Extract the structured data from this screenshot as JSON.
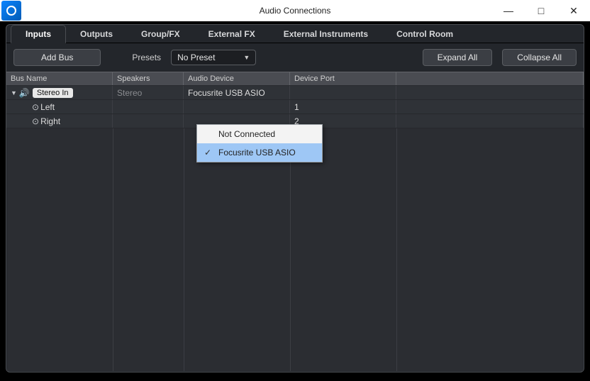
{
  "window": {
    "title": "Audio Connections"
  },
  "tabs": {
    "inputs": "Inputs",
    "outputs": "Outputs",
    "groupfx": "Group/FX",
    "externalfx": "External FX",
    "externalinst": "External Instruments",
    "controlroom": "Control Room"
  },
  "toolbar": {
    "add_bus": "Add Bus",
    "presets_label": "Presets",
    "preset_value": "No Preset",
    "expand_all": "Expand All",
    "collapse_all": "Collapse All"
  },
  "columns": {
    "bus_name": "Bus Name",
    "speakers": "Speakers",
    "audio_device": "Audio Device",
    "device_port": "Device Port"
  },
  "rows": {
    "bus": {
      "name": "Stereo In",
      "speakers": "Stereo",
      "device": "Focusrite USB ASIO"
    },
    "left": {
      "label": "Left",
      "port": "1"
    },
    "right": {
      "label": "Right",
      "port": "2"
    }
  },
  "menu": {
    "not_connected": "Not Connected",
    "focusrite": "Focusrite USB ASIO"
  }
}
